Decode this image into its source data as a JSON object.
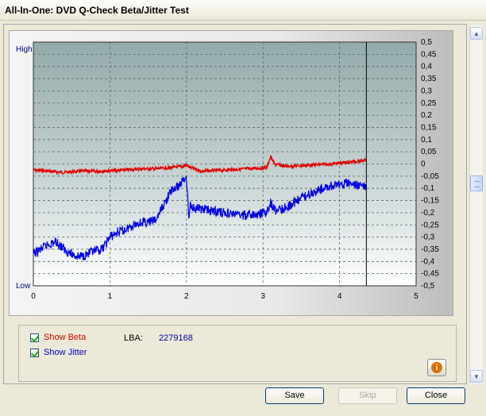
{
  "window": {
    "title": "All-In-One: DVD Q-Check Beta/Jitter Test"
  },
  "chart_data": {
    "type": "line",
    "left_axis": {
      "top_label": "High",
      "bottom_label": "Low"
    },
    "x_ticks": [
      "0",
      "1",
      "2",
      "3",
      "4",
      "5"
    ],
    "xlim": [
      0,
      5
    ],
    "y_right_ticks": [
      "0,5",
      "0,45",
      "0,4",
      "0,35",
      "0,3",
      "0,25",
      "0,2",
      "0,15",
      "0,1",
      "0,05",
      "0",
      "-0,05",
      "-0,1",
      "-0,15",
      "-0,2",
      "-0,25",
      "-0,3",
      "-0,35",
      "-0,4",
      "-0,45",
      "-0,5"
    ],
    "ylim": [
      -0.5,
      0.5
    ],
    "end_marker_x": 4.35,
    "grid": true,
    "series": [
      {
        "color": "#e00000",
        "x": [
          0,
          0.2,
          0.4,
          0.6,
          0.8,
          1.0,
          1.2,
          1.4,
          1.6,
          1.8,
          1.95,
          2.0,
          2.05,
          2.2,
          2.5,
          2.8,
          3.05,
          3.1,
          3.15,
          3.3,
          3.6,
          3.9,
          4.2,
          4.35
        ],
        "y": [
          -0.025,
          -0.03,
          -0.035,
          -0.03,
          -0.03,
          -0.028,
          -0.025,
          -0.02,
          -0.02,
          -0.015,
          -0.01,
          -0.005,
          -0.015,
          -0.03,
          -0.025,
          -0.02,
          -0.015,
          0.03,
          0.0,
          -0.01,
          -0.005,
          0.0,
          0.01,
          0.015
        ]
      },
      {
        "color": "#0000e0",
        "x": [
          0,
          0.1,
          0.2,
          0.3,
          0.4,
          0.5,
          0.6,
          0.7,
          0.8,
          0.9,
          1.0,
          1.1,
          1.2,
          1.3,
          1.4,
          1.5,
          1.6,
          1.65,
          1.7,
          1.75,
          1.8,
          1.85,
          1.9,
          1.95,
          2.0,
          2.03,
          2.05,
          2.1,
          2.3,
          2.5,
          2.7,
          2.9,
          3.05,
          3.1,
          3.15,
          3.3,
          3.5,
          3.7,
          3.9,
          4.1,
          4.3,
          4.35
        ],
        "y": [
          -0.37,
          -0.35,
          -0.33,
          -0.32,
          -0.35,
          -0.37,
          -0.38,
          -0.37,
          -0.36,
          -0.35,
          -0.3,
          -0.28,
          -0.27,
          -0.25,
          -0.24,
          -0.24,
          -0.23,
          -0.2,
          -0.17,
          -0.14,
          -0.11,
          -0.1,
          -0.09,
          -0.07,
          -0.05,
          -0.22,
          -0.17,
          -0.18,
          -0.19,
          -0.2,
          -0.21,
          -0.21,
          -0.2,
          -0.16,
          -0.19,
          -0.18,
          -0.14,
          -0.11,
          -0.09,
          -0.08,
          -0.09,
          -0.1
        ]
      }
    ]
  },
  "controls": {
    "show_beta_label": "Show Beta",
    "show_jitter_label": "Show Jitter",
    "lba_label": "LBA:",
    "lba_value": "2279168",
    "info_icon": "info-icon",
    "info_glyph": "i"
  },
  "buttons": {
    "save": "Save",
    "skip": "Skip",
    "close": "Close"
  },
  "scroll": {
    "up_glyph": "▲",
    "down_glyph": "▼"
  }
}
